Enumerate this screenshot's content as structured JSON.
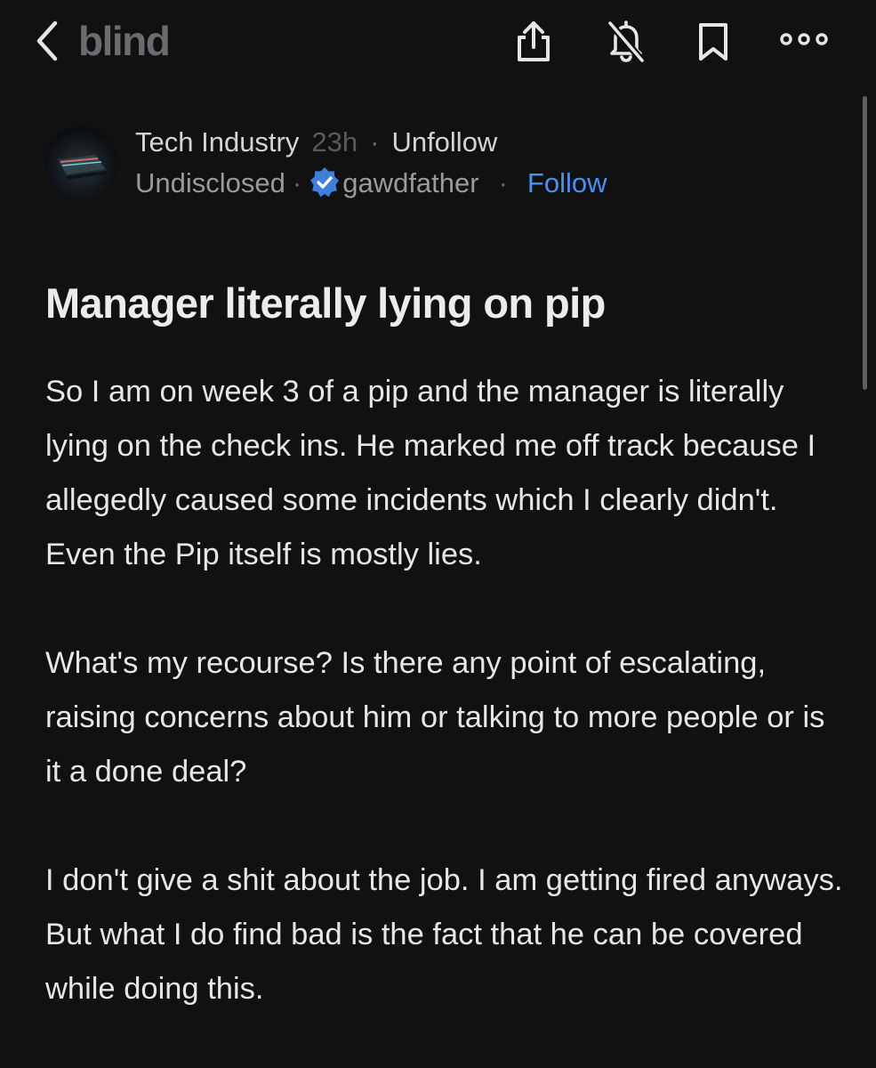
{
  "app": {
    "brand": "blind"
  },
  "icons": {
    "back": "chevron-left-icon",
    "share": "share-icon",
    "mute": "bell-off-icon",
    "bookmark": "bookmark-icon",
    "more": "more-horizontal-icon",
    "verified": "verified-badge-icon"
  },
  "colors": {
    "background": "#111112",
    "brand": "#6b6b70",
    "link": "#4b8ff5",
    "verified": "#3f7fd9"
  },
  "post": {
    "channel": "Tech Industry",
    "age": "23h",
    "channel_action": "Unfollow",
    "company": "Undisclosed",
    "author": "gawdfather",
    "author_action": "Follow",
    "title": "Manager literally lying on pip",
    "paragraphs": [
      "So I am on week 3 of a pip and the manager is literally lying on the check ins. He marked me off track because I  allegedly caused some incidents which I clearly didn't.  Even the Pip itself is mostly lies.",
      "What's my recourse? Is there any point of escalating, raising concerns about him or talking to more people or is it a done deal?",
      "I don't give a shit about the job. I am getting fired anyways.  But what I do find bad is the fact that he can be covered while doing this."
    ]
  }
}
